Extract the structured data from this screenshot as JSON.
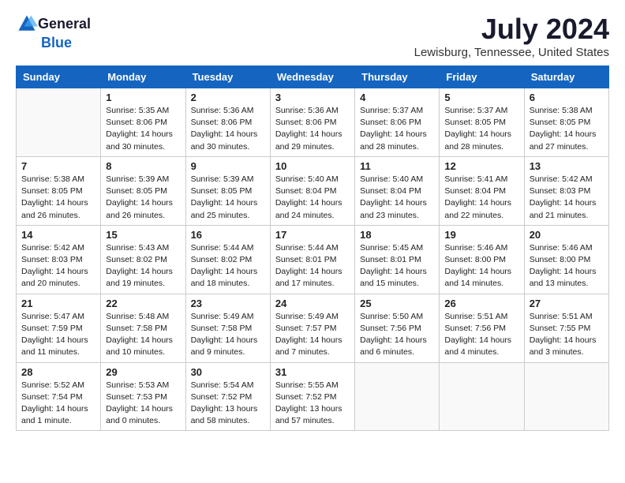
{
  "app": {
    "logo_general": "General",
    "logo_blue": "Blue",
    "title": "July 2024",
    "subtitle": "Lewisburg, Tennessee, United States"
  },
  "calendar": {
    "headers": [
      "Sunday",
      "Monday",
      "Tuesday",
      "Wednesday",
      "Thursday",
      "Friday",
      "Saturday"
    ],
    "weeks": [
      [
        {
          "day": "",
          "info": ""
        },
        {
          "day": "1",
          "info": "Sunrise: 5:35 AM\nSunset: 8:06 PM\nDaylight: 14 hours\nand 30 minutes."
        },
        {
          "day": "2",
          "info": "Sunrise: 5:36 AM\nSunset: 8:06 PM\nDaylight: 14 hours\nand 30 minutes."
        },
        {
          "day": "3",
          "info": "Sunrise: 5:36 AM\nSunset: 8:06 PM\nDaylight: 14 hours\nand 29 minutes."
        },
        {
          "day": "4",
          "info": "Sunrise: 5:37 AM\nSunset: 8:06 PM\nDaylight: 14 hours\nand 28 minutes."
        },
        {
          "day": "5",
          "info": "Sunrise: 5:37 AM\nSunset: 8:05 PM\nDaylight: 14 hours\nand 28 minutes."
        },
        {
          "day": "6",
          "info": "Sunrise: 5:38 AM\nSunset: 8:05 PM\nDaylight: 14 hours\nand 27 minutes."
        }
      ],
      [
        {
          "day": "7",
          "info": "Sunrise: 5:38 AM\nSunset: 8:05 PM\nDaylight: 14 hours\nand 26 minutes."
        },
        {
          "day": "8",
          "info": "Sunrise: 5:39 AM\nSunset: 8:05 PM\nDaylight: 14 hours\nand 26 minutes."
        },
        {
          "day": "9",
          "info": "Sunrise: 5:39 AM\nSunset: 8:05 PM\nDaylight: 14 hours\nand 25 minutes."
        },
        {
          "day": "10",
          "info": "Sunrise: 5:40 AM\nSunset: 8:04 PM\nDaylight: 14 hours\nand 24 minutes."
        },
        {
          "day": "11",
          "info": "Sunrise: 5:40 AM\nSunset: 8:04 PM\nDaylight: 14 hours\nand 23 minutes."
        },
        {
          "day": "12",
          "info": "Sunrise: 5:41 AM\nSunset: 8:04 PM\nDaylight: 14 hours\nand 22 minutes."
        },
        {
          "day": "13",
          "info": "Sunrise: 5:42 AM\nSunset: 8:03 PM\nDaylight: 14 hours\nand 21 minutes."
        }
      ],
      [
        {
          "day": "14",
          "info": "Sunrise: 5:42 AM\nSunset: 8:03 PM\nDaylight: 14 hours\nand 20 minutes."
        },
        {
          "day": "15",
          "info": "Sunrise: 5:43 AM\nSunset: 8:02 PM\nDaylight: 14 hours\nand 19 minutes."
        },
        {
          "day": "16",
          "info": "Sunrise: 5:44 AM\nSunset: 8:02 PM\nDaylight: 14 hours\nand 18 minutes."
        },
        {
          "day": "17",
          "info": "Sunrise: 5:44 AM\nSunset: 8:01 PM\nDaylight: 14 hours\nand 17 minutes."
        },
        {
          "day": "18",
          "info": "Sunrise: 5:45 AM\nSunset: 8:01 PM\nDaylight: 14 hours\nand 15 minutes."
        },
        {
          "day": "19",
          "info": "Sunrise: 5:46 AM\nSunset: 8:00 PM\nDaylight: 14 hours\nand 14 minutes."
        },
        {
          "day": "20",
          "info": "Sunrise: 5:46 AM\nSunset: 8:00 PM\nDaylight: 14 hours\nand 13 minutes."
        }
      ],
      [
        {
          "day": "21",
          "info": "Sunrise: 5:47 AM\nSunset: 7:59 PM\nDaylight: 14 hours\nand 11 minutes."
        },
        {
          "day": "22",
          "info": "Sunrise: 5:48 AM\nSunset: 7:58 PM\nDaylight: 14 hours\nand 10 minutes."
        },
        {
          "day": "23",
          "info": "Sunrise: 5:49 AM\nSunset: 7:58 PM\nDaylight: 14 hours\nand 9 minutes."
        },
        {
          "day": "24",
          "info": "Sunrise: 5:49 AM\nSunset: 7:57 PM\nDaylight: 14 hours\nand 7 minutes."
        },
        {
          "day": "25",
          "info": "Sunrise: 5:50 AM\nSunset: 7:56 PM\nDaylight: 14 hours\nand 6 minutes."
        },
        {
          "day": "26",
          "info": "Sunrise: 5:51 AM\nSunset: 7:56 PM\nDaylight: 14 hours\nand 4 minutes."
        },
        {
          "day": "27",
          "info": "Sunrise: 5:51 AM\nSunset: 7:55 PM\nDaylight: 14 hours\nand 3 minutes."
        }
      ],
      [
        {
          "day": "28",
          "info": "Sunrise: 5:52 AM\nSunset: 7:54 PM\nDaylight: 14 hours\nand 1 minute."
        },
        {
          "day": "29",
          "info": "Sunrise: 5:53 AM\nSunset: 7:53 PM\nDaylight: 14 hours\nand 0 minutes."
        },
        {
          "day": "30",
          "info": "Sunrise: 5:54 AM\nSunset: 7:52 PM\nDaylight: 13 hours\nand 58 minutes."
        },
        {
          "day": "31",
          "info": "Sunrise: 5:55 AM\nSunset: 7:52 PM\nDaylight: 13 hours\nand 57 minutes."
        },
        {
          "day": "",
          "info": ""
        },
        {
          "day": "",
          "info": ""
        },
        {
          "day": "",
          "info": ""
        }
      ]
    ]
  }
}
